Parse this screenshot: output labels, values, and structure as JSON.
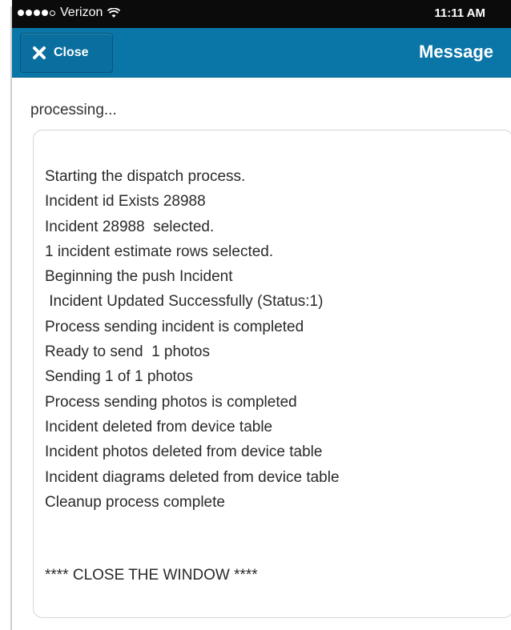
{
  "status_bar": {
    "carrier": "Verizon",
    "time": "11:11 AM"
  },
  "header": {
    "close_label": "Close",
    "title": "Message"
  },
  "processing_label": "processing...",
  "log": {
    "lines": [
      "Starting the dispatch process.",
      "Incident id Exists 28988",
      "Incident 28988  selected.",
      "1 incident estimate rows selected.",
      "Beginning the push Incident",
      " Incident Updated Successfully (Status:1)",
      "Process sending incident is completed",
      "Ready to send  1 photos",
      "Sending 1 of 1 photos",
      "Process sending photos is completed",
      "Incident deleted from device table",
      "Incident photos deleted from device table",
      "Incident diagrams deleted from device table",
      "Cleanup process complete"
    ],
    "footer": "**** CLOSE THE WINDOW ****"
  },
  "colors": {
    "header_bg": "#0a76a8",
    "status_bar_bg": "#0b0b0b"
  }
}
